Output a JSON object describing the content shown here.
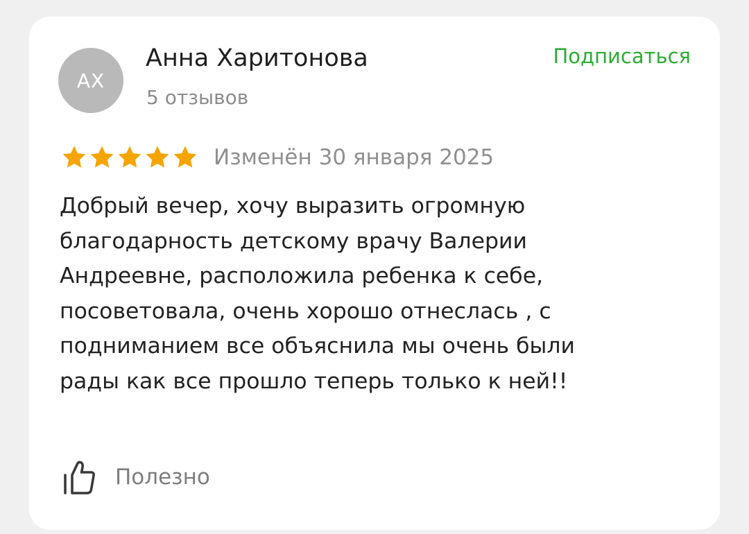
{
  "review": {
    "author": {
      "initials": "АХ",
      "name": "Анна Харитонова",
      "reviews_count": "5 отзывов"
    },
    "subscribe_label": "Подписаться",
    "rating": 5,
    "max_rating": 5,
    "edited_date": "Изменён 30 января 2025",
    "text": "Добрый вечер, хочу выразить огромную\nблагодарность детскому врачу Валерии\nАндреевне, расположила ребенка к себе,\nпосоветовала, очень хорошо отнеслась , с\nподниманием все объяснила мы очень были\nрады как все прошло теперь только к ней!!",
    "helpful_label": "Полезно"
  },
  "colors": {
    "accent_green": "#2bab33",
    "star": "#f6a400",
    "avatar_bg": "#b9b9b9"
  },
  "icons": {
    "star": "star-icon",
    "helpful": "thumbs-up-icon"
  }
}
